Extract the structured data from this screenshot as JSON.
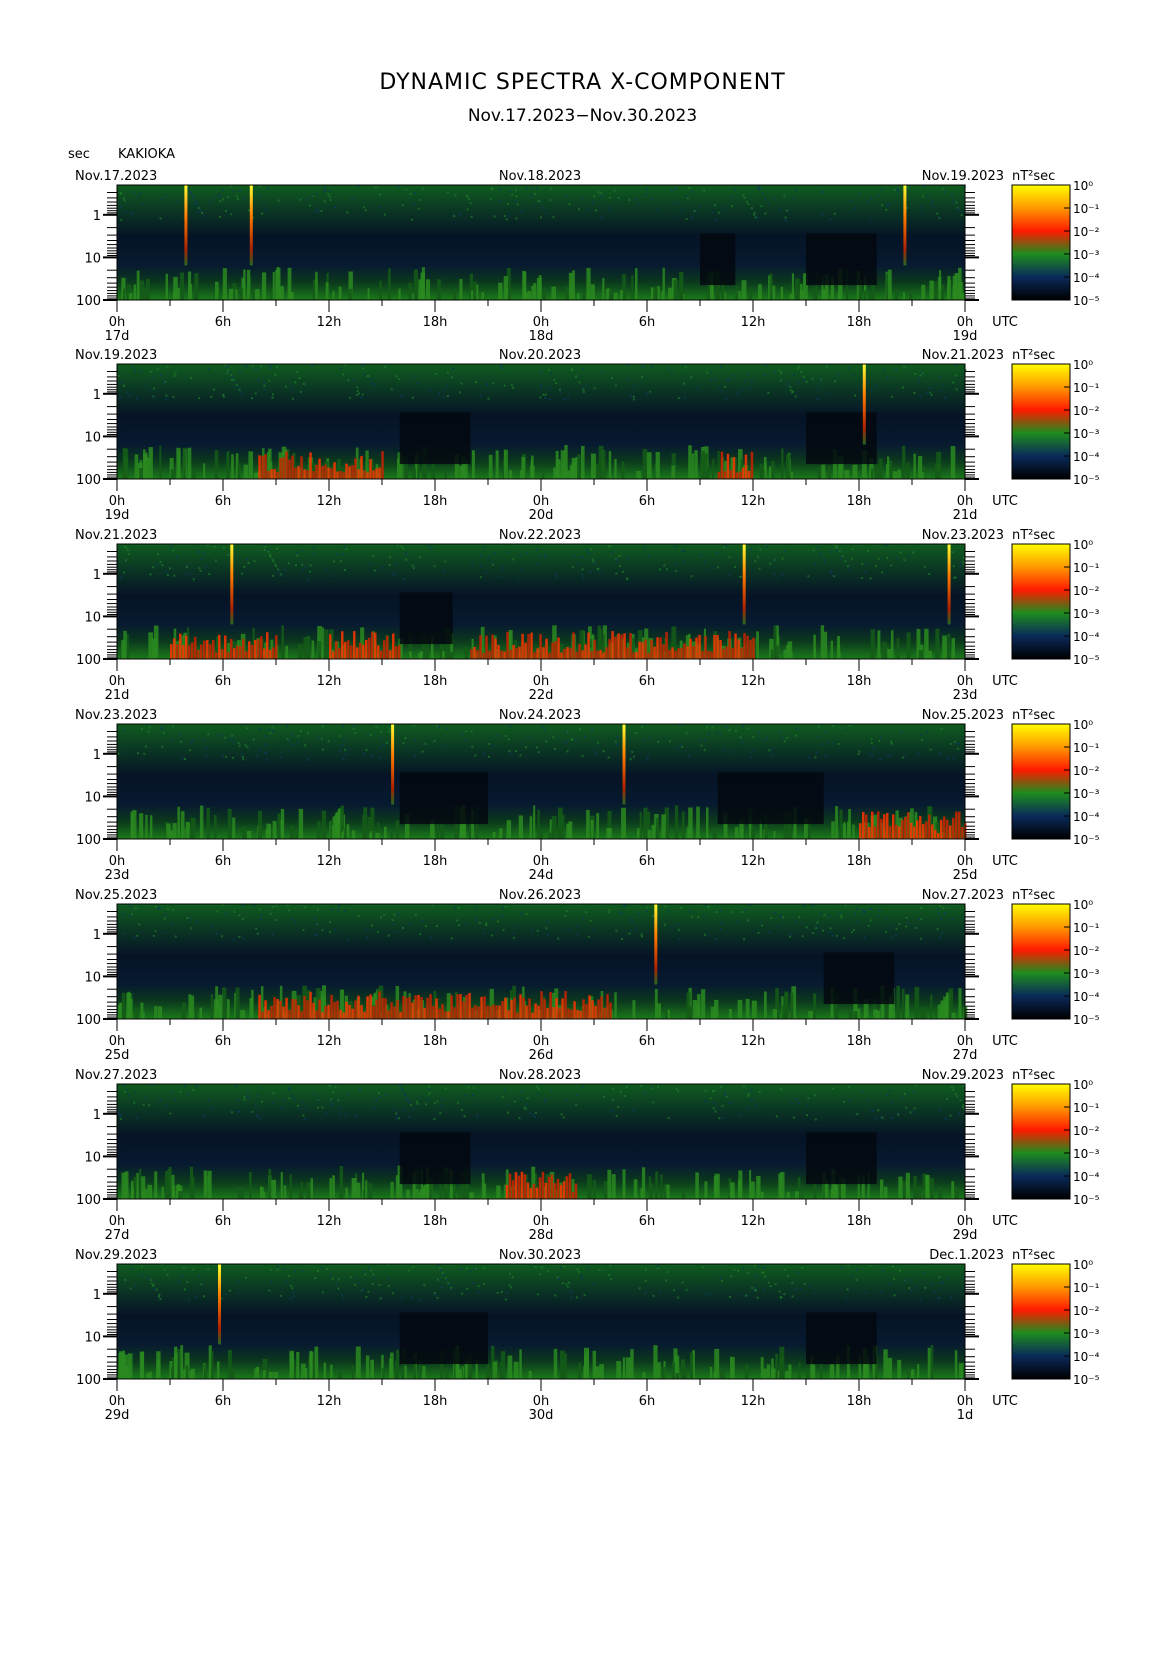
{
  "header": {
    "title": "DYNAMIC SPECTRA X-COMPONENT",
    "subtitle": "Nov.17.2023−Nov.30.2023",
    "unit_label": "sec",
    "station": "KAKIOKA"
  },
  "colorbar": {
    "unit": "nT²sec",
    "ticks": [
      "10⁰",
      "10⁻¹",
      "10⁻²",
      "10⁻³",
      "10⁻⁴",
      "10⁻⁵"
    ],
    "colors": [
      "#ffff00",
      "#ff8c00",
      "#ff1a00",
      "#1e8c1e",
      "#0a2a5a",
      "#000000"
    ]
  },
  "chart_data": [
    {
      "type": "heatmap",
      "date_left": "Nov.17.2023",
      "date_mid": "Nov.18.2023",
      "date_right": "Nov.19.2023",
      "day_labels": [
        "17d",
        "18d",
        "19d"
      ],
      "x_ticks": [
        "0h",
        "6h",
        "12h",
        "18h",
        "0h",
        "6h",
        "12h",
        "18h",
        "0h"
      ],
      "x_unit": "UTC",
      "y_ticks": [
        "1",
        "10",
        "100"
      ],
      "ylabel": "sec",
      "quiet_intervals_h": [
        [
          33,
          35
        ],
        [
          39,
          43
        ]
      ],
      "spikes_h": [
        3.9,
        7.6,
        44.6
      ],
      "enhanced_intervals_h": []
    },
    {
      "type": "heatmap",
      "date_left": "Nov.19.2023",
      "date_mid": "Nov.20.2023",
      "date_right": "Nov.21.2023",
      "day_labels": [
        "19d",
        "20d",
        "21d"
      ],
      "x_ticks": [
        "0h",
        "6h",
        "12h",
        "18h",
        "0h",
        "6h",
        "12h",
        "18h",
        "0h"
      ],
      "x_unit": "UTC",
      "y_ticks": [
        "1",
        "10",
        "100"
      ],
      "ylabel": "sec",
      "quiet_intervals_h": [
        [
          16,
          20
        ],
        [
          39,
          43
        ]
      ],
      "spikes_h": [
        42.3
      ],
      "enhanced_intervals_h": [
        [
          8,
          15
        ],
        [
          34,
          36
        ]
      ]
    },
    {
      "type": "heatmap",
      "date_left": "Nov.21.2023",
      "date_mid": "Nov.22.2023",
      "date_right": "Nov.23.2023",
      "day_labels": [
        "21d",
        "22d",
        "23d"
      ],
      "x_ticks": [
        "0h",
        "6h",
        "12h",
        "18h",
        "0h",
        "6h",
        "12h",
        "18h",
        "0h"
      ],
      "x_unit": "UTC",
      "y_ticks": [
        "1",
        "10",
        "100"
      ],
      "ylabel": "sec",
      "quiet_intervals_h": [
        [
          16,
          19
        ]
      ],
      "spikes_h": [
        6.5,
        35.5,
        47.1
      ],
      "enhanced_intervals_h": [
        [
          3,
          9
        ],
        [
          12,
          16
        ],
        [
          20,
          36
        ]
      ]
    },
    {
      "type": "heatmap",
      "date_left": "Nov.23.2023",
      "date_mid": "Nov.24.2023",
      "date_right": "Nov.25.2023",
      "day_labels": [
        "23d",
        "24d",
        "25d"
      ],
      "x_ticks": [
        "0h",
        "6h",
        "12h",
        "18h",
        "0h",
        "6h",
        "12h",
        "18h",
        "0h"
      ],
      "x_unit": "UTC",
      "y_ticks": [
        "1",
        "10",
        "100"
      ],
      "ylabel": "sec",
      "quiet_intervals_h": [
        [
          16,
          21
        ],
        [
          34,
          40
        ]
      ],
      "spikes_h": [
        15.6,
        28.7
      ],
      "enhanced_intervals_h": [
        [
          42,
          48
        ]
      ]
    },
    {
      "type": "heatmap",
      "date_left": "Nov.25.2023",
      "date_mid": "Nov.26.2023",
      "date_right": "Nov.27.2023",
      "day_labels": [
        "25d",
        "26d",
        "27d"
      ],
      "x_ticks": [
        "0h",
        "6h",
        "12h",
        "18h",
        "0h",
        "6h",
        "12h",
        "18h",
        "0h"
      ],
      "x_unit": "UTC",
      "y_ticks": [
        "1",
        "10",
        "100"
      ],
      "ylabel": "sec",
      "quiet_intervals_h": [
        [
          40,
          44
        ]
      ],
      "spikes_h": [
        30.5
      ],
      "enhanced_intervals_h": [
        [
          8,
          28
        ]
      ]
    },
    {
      "type": "heatmap",
      "date_left": "Nov.27.2023",
      "date_mid": "Nov.28.2023",
      "date_right": "Nov.29.2023",
      "day_labels": [
        "27d",
        "28d",
        "29d"
      ],
      "x_ticks": [
        "0h",
        "6h",
        "12h",
        "18h",
        "0h",
        "6h",
        "12h",
        "18h",
        "0h"
      ],
      "x_unit": "UTC",
      "y_ticks": [
        "1",
        "10",
        "100"
      ],
      "ylabel": "sec",
      "quiet_intervals_h": [
        [
          16,
          20
        ],
        [
          39,
          43
        ]
      ],
      "spikes_h": [],
      "enhanced_intervals_h": [
        [
          22,
          26
        ]
      ]
    },
    {
      "type": "heatmap",
      "date_left": "Nov.29.2023",
      "date_mid": "Nov.30.2023",
      "date_right": "Dec.1.2023",
      "day_labels": [
        "29d",
        "30d",
        "1d"
      ],
      "x_ticks": [
        "0h",
        "6h",
        "12h",
        "18h",
        "0h",
        "6h",
        "12h",
        "18h",
        "0h"
      ],
      "x_unit": "UTC",
      "y_ticks": [
        "1",
        "10",
        "100"
      ],
      "ylabel": "sec",
      "quiet_intervals_h": [
        [
          16,
          21
        ],
        [
          39,
          43
        ]
      ],
      "spikes_h": [
        5.8
      ],
      "enhanced_intervals_h": []
    }
  ]
}
